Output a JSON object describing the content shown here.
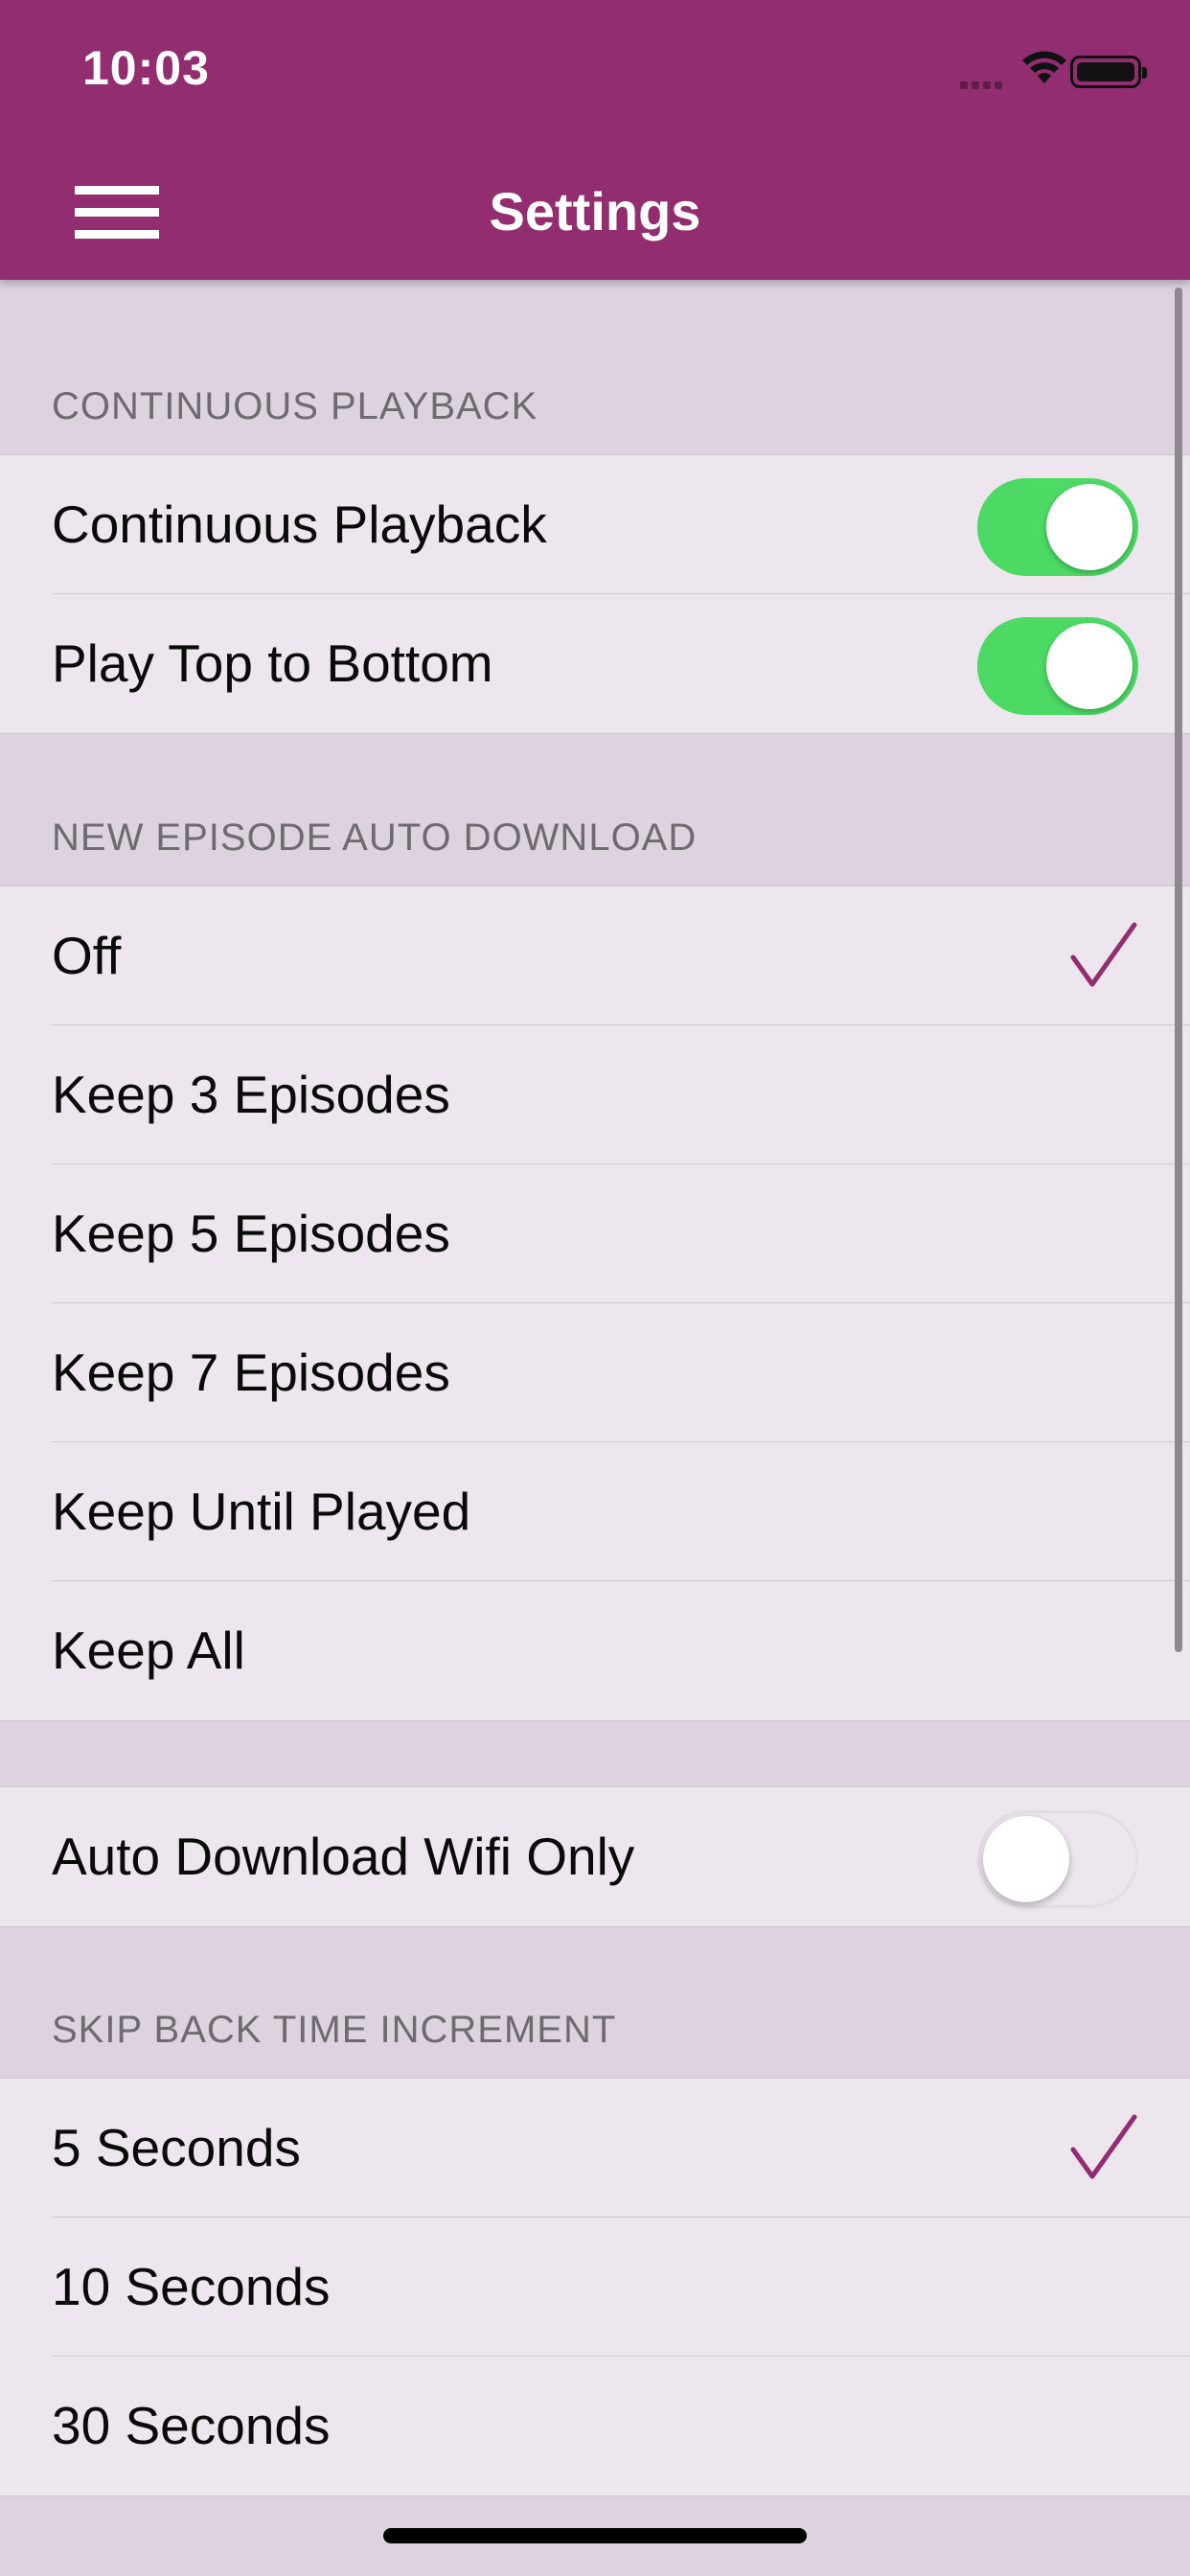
{
  "status_bar": {
    "time": "10:03"
  },
  "header": {
    "title": "Settings"
  },
  "sections": {
    "continuous_playback": {
      "header": "CONTINUOUS PLAYBACK",
      "rows": [
        {
          "label": "Continuous Playback",
          "toggle": "on"
        },
        {
          "label": "Play Top to Bottom",
          "toggle": "on"
        }
      ]
    },
    "auto_download": {
      "header": "NEW EPISODE AUTO DOWNLOAD",
      "rows": [
        {
          "label": "Off",
          "selected": true
        },
        {
          "label": "Keep 3 Episodes",
          "selected": false
        },
        {
          "label": "Keep 5 Episodes",
          "selected": false
        },
        {
          "label": "Keep 7 Episodes",
          "selected": false
        },
        {
          "label": "Keep Until Played",
          "selected": false
        },
        {
          "label": "Keep All",
          "selected": false
        }
      ]
    },
    "wifi": {
      "rows": [
        {
          "label": "Auto Download Wifi Only",
          "toggle": "off"
        }
      ]
    },
    "skip_back": {
      "header": "SKIP BACK TIME INCREMENT",
      "rows": [
        {
          "label": "5 Seconds",
          "selected": true
        },
        {
          "label": "10 Seconds",
          "selected": false
        },
        {
          "label": "30 Seconds",
          "selected": false
        }
      ]
    }
  },
  "colors": {
    "brand": "#922d70",
    "toggle_on": "#4cd964",
    "checkmark": "#922d70",
    "background": "#ddd3df",
    "cell": "#ede6ee"
  },
  "icons": {
    "menu": "hamburger-menu-icon",
    "check": "checkmark-icon",
    "wifi": "wifi-icon",
    "battery": "battery-icon",
    "signal": "cellular-signal-icon"
  }
}
